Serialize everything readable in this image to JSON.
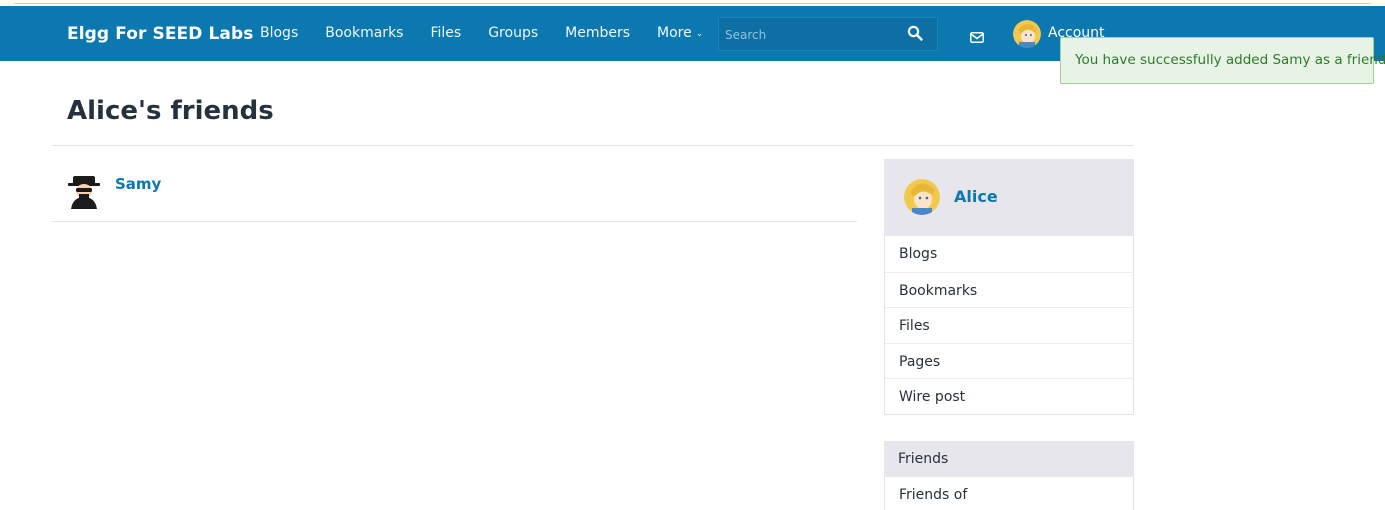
{
  "navbar": {
    "brand": "Elgg For SEED Labs",
    "links": [
      "Blogs",
      "Bookmarks",
      "Files",
      "Groups",
      "Members"
    ],
    "more_label": "More",
    "search_placeholder": "Search",
    "account_label": "Account",
    "icons": {
      "search": "search-icon",
      "mail": "mail-icon",
      "caret": "chevron-down-icon"
    }
  },
  "flash": {
    "message": "You have successfully added Samy as a friend."
  },
  "page": {
    "title": "Alice's friends"
  },
  "friends": [
    {
      "name": "Samy"
    }
  ],
  "owner": {
    "name": "Alice",
    "menu": [
      "Blogs",
      "Bookmarks",
      "Files",
      "Pages",
      "Wire post"
    ]
  },
  "friends_menu": {
    "items": [
      "Friends",
      "Friends of"
    ]
  },
  "colors": {
    "brand": "#0b78b0",
    "flash_bg": "#e7f3e5",
    "flash_text": "#2d7a2a",
    "panel": "#e6e6ec"
  }
}
